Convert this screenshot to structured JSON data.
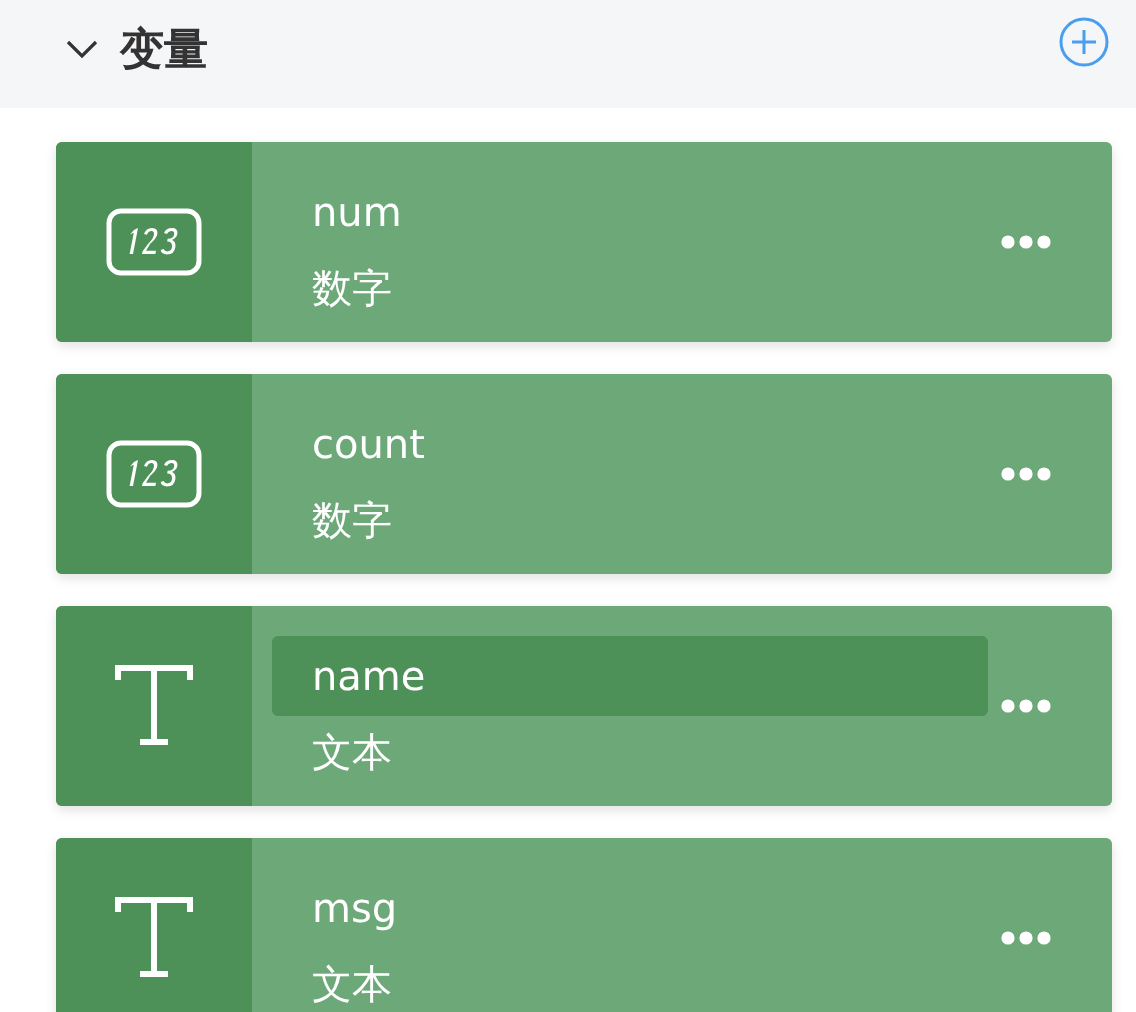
{
  "section": {
    "title": "变量",
    "expanded": true
  },
  "variables": [
    {
      "name": "num",
      "type": "数字",
      "kind": "number",
      "highlighted": false
    },
    {
      "name": "count",
      "type": "数字",
      "kind": "number",
      "highlighted": false
    },
    {
      "name": "name",
      "type": "文本",
      "kind": "text",
      "highlighted": true
    },
    {
      "name": "msg",
      "type": "文本",
      "kind": "text",
      "highlighted": false
    }
  ]
}
